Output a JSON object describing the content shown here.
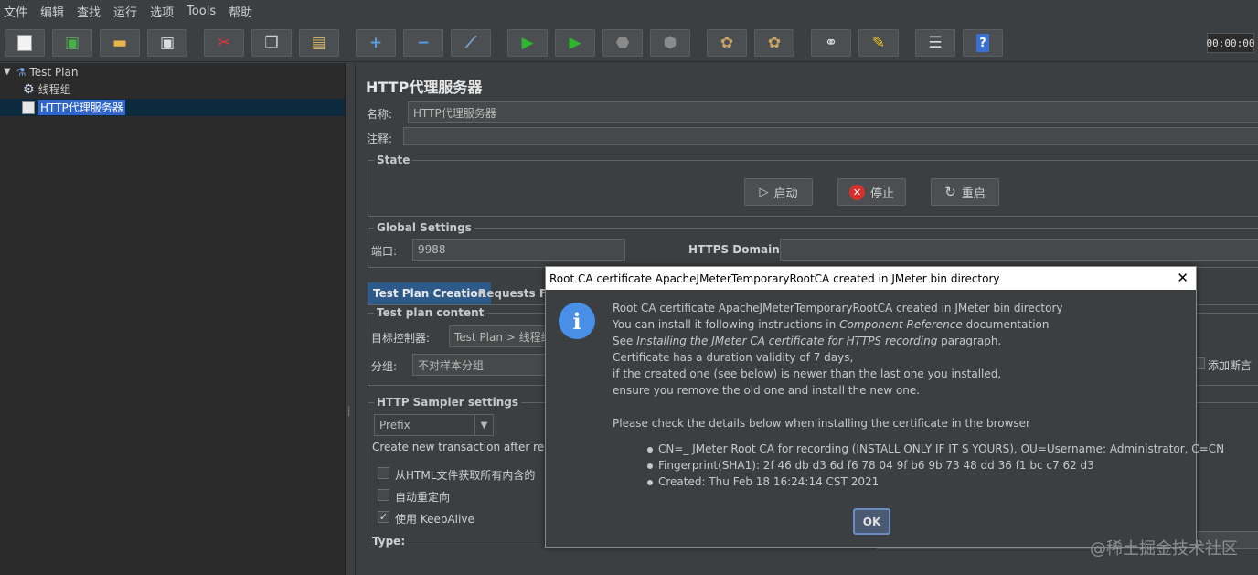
{
  "menubar": [
    "文件",
    "编辑",
    "查找",
    "运行",
    "选项",
    "Tools",
    "帮助"
  ],
  "toolbar": {
    "timer": "00:00:00"
  },
  "tree": {
    "items": [
      {
        "label": "Test Plan"
      },
      {
        "label": "线程组"
      },
      {
        "label": "HTTP代理服务器"
      }
    ]
  },
  "panel": {
    "title": "HTTP代理服务器",
    "name_label": "名称:",
    "name_value": "HTTP代理服务器",
    "comment_label": "注释:",
    "state_title": "State",
    "start_label": "启动",
    "stop_label": "停止",
    "restart_label": "重启",
    "global_title": "Global Settings",
    "port_label": "端口:",
    "port_value": "9988",
    "https_label": "HTTPS Domains:",
    "tabs": [
      "Test Plan Creation",
      "Requests Filt"
    ],
    "content_title": "Test plan content",
    "target_label": "目标控制器:",
    "target_value": "Test Plan > 线程组",
    "group_label": "分组:",
    "group_value": "不对样本分组",
    "add_assert": "添加断言",
    "sampler_title": "HTTP Sampler settings",
    "prefix_value": "Prefix",
    "create_tx": "Create new transaction after requ",
    "html_fetch": "从HTML文件获取所有内含的",
    "redirect": "自动重定向",
    "keepalive": "使用 KeepAlive",
    "type_label": "Type:"
  },
  "dialog": {
    "title": "Root CA certificate ApacheJMeterTemporaryRootCA created in JMeter bin directory",
    "lines": [
      "Root CA certificate ApacheJMeterTemporaryRootCA created in JMeter bin directory",
      "Certificate has a duration validity of 7 days,",
      "if the created one (see below) is newer than the last one you installed,",
      "ensure you remove the old one and install the new one.",
      "Please check the details below when installing the certificate in the browser"
    ],
    "line2_pre": "You can install it following instructions in ",
    "line2_em": "Component Reference",
    "line2_post": " documentation",
    "line3_pre": "See ",
    "line3_em": "Installing the JMeter CA certificate for HTTPS recording",
    "line3_post": " paragraph.",
    "bullets": [
      "CN=_ JMeter Root CA for recording (INSTALL ONLY IF IT S YOURS), OU=Username: Administrator, C=CN",
      "Fingerprint(SHA1): 2f 46 db d3 6d f6 78 04 9f b6 9b 73 48 dd 36 f1 bc c7 62 d3",
      "Created: Thu Feb 18 16:24:14 CST 2021"
    ],
    "ok_label": "OK"
  },
  "watermark": "@稀土掘金技术社区",
  "colors": {
    "background": "#3c3f41",
    "tree_background": "#2b2b2b",
    "selection": "#2f65ca",
    "info_icon": "#4a8fe7",
    "stop_icon": "#d9302c",
    "run_icon": "#2fb52f"
  }
}
